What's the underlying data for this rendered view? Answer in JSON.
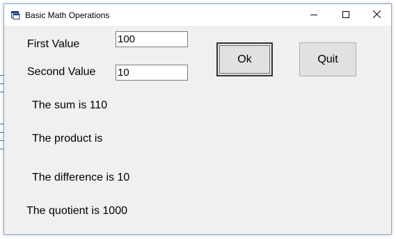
{
  "window": {
    "title": "Basic Math Operations"
  },
  "controls": {
    "first_label": "First Value",
    "first_value": "100",
    "second_label": "Second Value",
    "second_value": "10",
    "ok_label": "Ok",
    "quit_label": "Quit"
  },
  "results": {
    "sum": "The sum is 110",
    "product": "The product is",
    "difference": "The difference is 10",
    "quotient": "The quotient is 1000"
  },
  "icons": {
    "app": "app-window-icon",
    "minimize": "minimize-icon",
    "maximize": "maximize-icon",
    "close": "close-icon"
  },
  "colors": {
    "window_bg": "#f0f0f0",
    "titlebar_bg": "#ffffff",
    "button_bg": "#e1e1e1"
  }
}
